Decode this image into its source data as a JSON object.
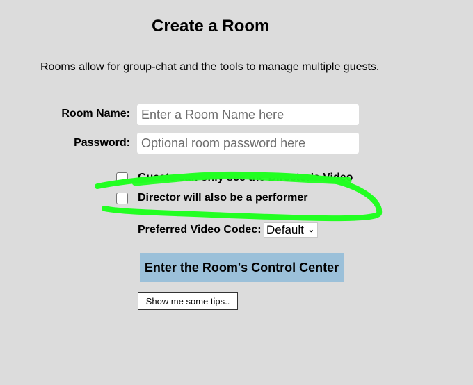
{
  "page": {
    "title": "Create a Room",
    "description": "Rooms allow for group-chat and the tools to manage multiple guests."
  },
  "form": {
    "room_name": {
      "label": "Room Name:",
      "placeholder": "Enter a Room Name here",
      "value": ""
    },
    "password": {
      "label": "Password:",
      "placeholder": "Optional room password here",
      "value": ""
    },
    "options": [
      {
        "label": "Guests can only see the Director's Video",
        "checked": false
      },
      {
        "label": "Director will also be a performer",
        "checked": false
      }
    ],
    "codec": {
      "label": "Preferred Video Codec:",
      "selected": "Default"
    }
  },
  "buttons": {
    "enter_control_center": "Enter the Room's Control Center",
    "show_tips": "Show me some tips.."
  },
  "colors": {
    "background": "#dcdcdc",
    "primary_button": "#9bc0d9",
    "annotation_highlight": "#22ff22"
  }
}
